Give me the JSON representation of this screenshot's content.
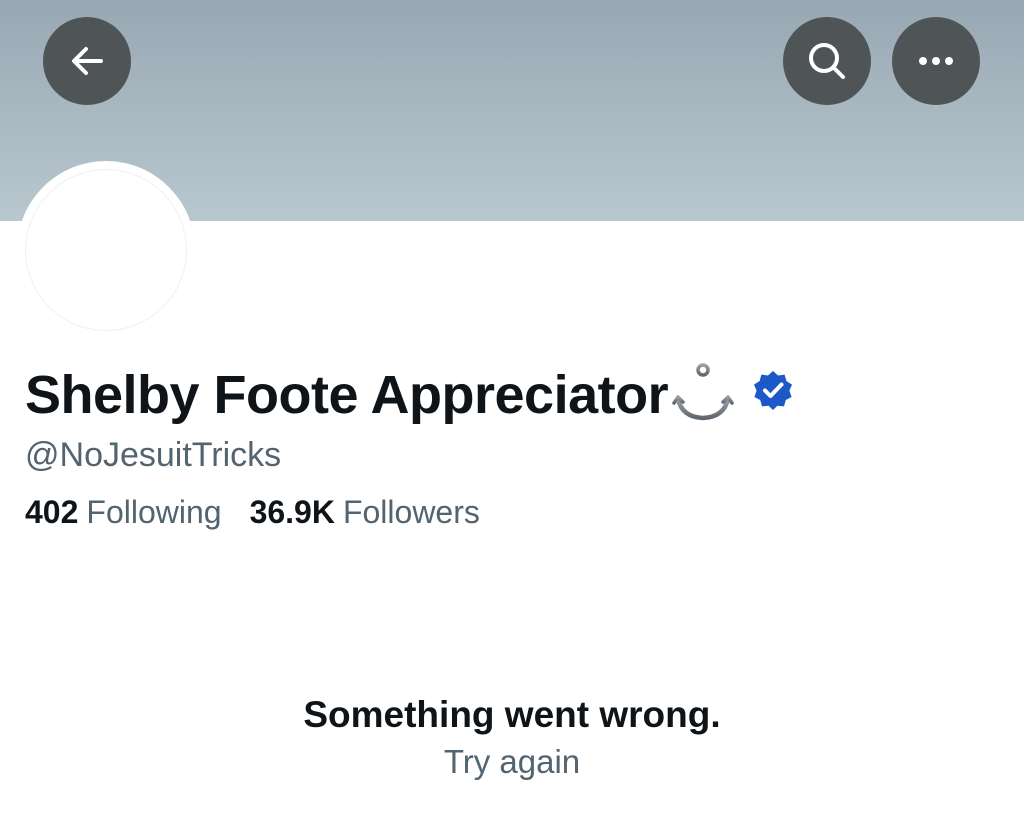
{
  "header": {
    "back_icon": "arrow-left-icon",
    "search_icon": "search-icon",
    "more_icon": "more-horizontal-icon"
  },
  "profile": {
    "display_name": "Shelby Foote Appreciator",
    "name_emoji": "anchor",
    "verified": true,
    "verified_color": "#1d58c9",
    "handle": "@NoJesuitTricks",
    "following_count": "402",
    "following_label": "Following",
    "followers_count": "36.9K",
    "followers_label": "Followers"
  },
  "error": {
    "title": "Something went wrong.",
    "retry_label": "Try again"
  },
  "colors": {
    "banner": "#a9b8c1",
    "header_button": "#4f5457",
    "text_primary": "#0f1419",
    "text_secondary": "#536471"
  }
}
